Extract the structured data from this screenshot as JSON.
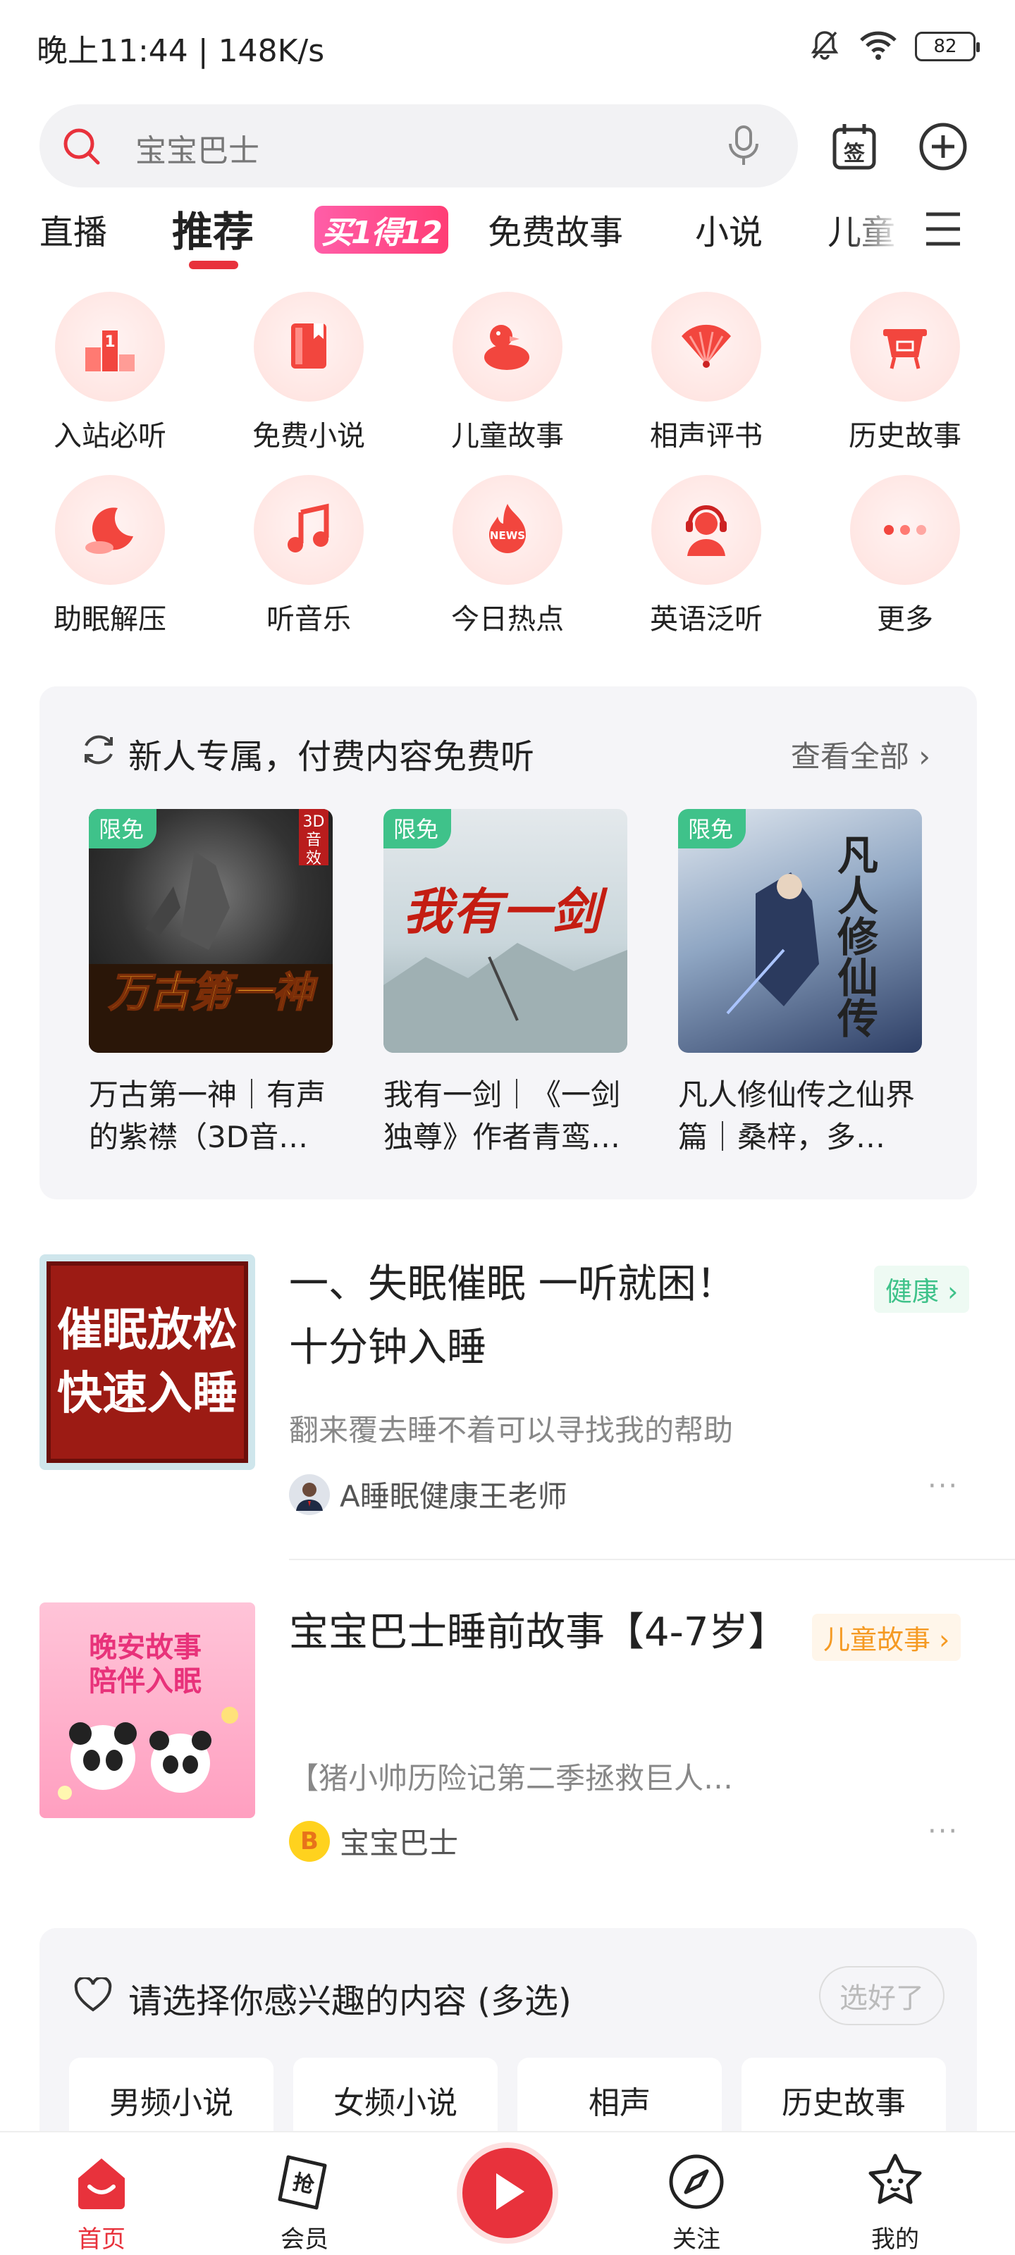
{
  "status": {
    "time_speed": "晚上11:44 | 148K/s",
    "battery": "82"
  },
  "search": {
    "placeholder": "宝宝巴士"
  },
  "tabs": [
    {
      "label": "直播"
    },
    {
      "label": "推荐"
    },
    {
      "label": "买1得12"
    },
    {
      "label": "免费故事"
    },
    {
      "label": "小说"
    },
    {
      "label": "儿童"
    }
  ],
  "quick": [
    {
      "label": "入站必听",
      "icon": "podium-icon"
    },
    {
      "label": "免费小说",
      "icon": "book-icon"
    },
    {
      "label": "儿童故事",
      "icon": "duck-icon"
    },
    {
      "label": "相声评书",
      "icon": "fan-icon"
    },
    {
      "label": "历史故事",
      "icon": "cauldron-icon"
    },
    {
      "label": "助眠解压",
      "icon": "moon-icon"
    },
    {
      "label": "听音乐",
      "icon": "music-note-icon"
    },
    {
      "label": "今日热点",
      "icon": "news-flame-icon"
    },
    {
      "label": "英语泛听",
      "icon": "headset-person-icon"
    },
    {
      "label": "更多",
      "icon": "more-dots-icon"
    }
  ],
  "newuser": {
    "title": "新人专属，付费内容免费听",
    "more": "查看全部 ›",
    "books": [
      {
        "tag": "限免",
        "title": "万古第一神｜有声的紫襟（3D音…",
        "cover_text": "万古第一神"
      },
      {
        "tag": "限免",
        "title": "我有一剑｜《一剑独尊》作者青鸾…",
        "cover_text": "我有一剑"
      },
      {
        "tag": "限免",
        "title": "凡人修仙传之仙界篇｜桑梓，多…",
        "cover_text": "凡人修仙传"
      }
    ]
  },
  "feed": [
    {
      "title": "一、失眠催眠 一听就困！十分钟入睡",
      "desc": "翻来覆去睡不着可以寻找我的帮助",
      "author": "A睡眠健康王老师",
      "tag": "健康 ›",
      "cover_line1": "催眠放松",
      "cover_line2": "快速入睡",
      "more": "···"
    },
    {
      "title": "宝宝巴士睡前故事【4-7岁】",
      "desc": "【猪小帅历险记第二季拯救巨人…",
      "author": "宝宝巴士",
      "tag": "儿童故事 ›",
      "cover_line1": "晚安故事",
      "cover_line2": "陪伴入眠",
      "more": "···"
    }
  ],
  "interest": {
    "title": "请选择你感兴趣的内容 (多选)",
    "done": "选好了",
    "chips": [
      "男频小说",
      "女频小说",
      "相声",
      "历史故事"
    ]
  },
  "nav": [
    {
      "label": "首页",
      "active": true
    },
    {
      "label": "会员"
    },
    {
      "label": "关注"
    },
    {
      "label": "我的"
    }
  ],
  "colors": {
    "accent": "#e8323c",
    "free_tag": "#3fc28a",
    "health_tag": "#3fc28a",
    "kids_tag": "#f59a23"
  }
}
